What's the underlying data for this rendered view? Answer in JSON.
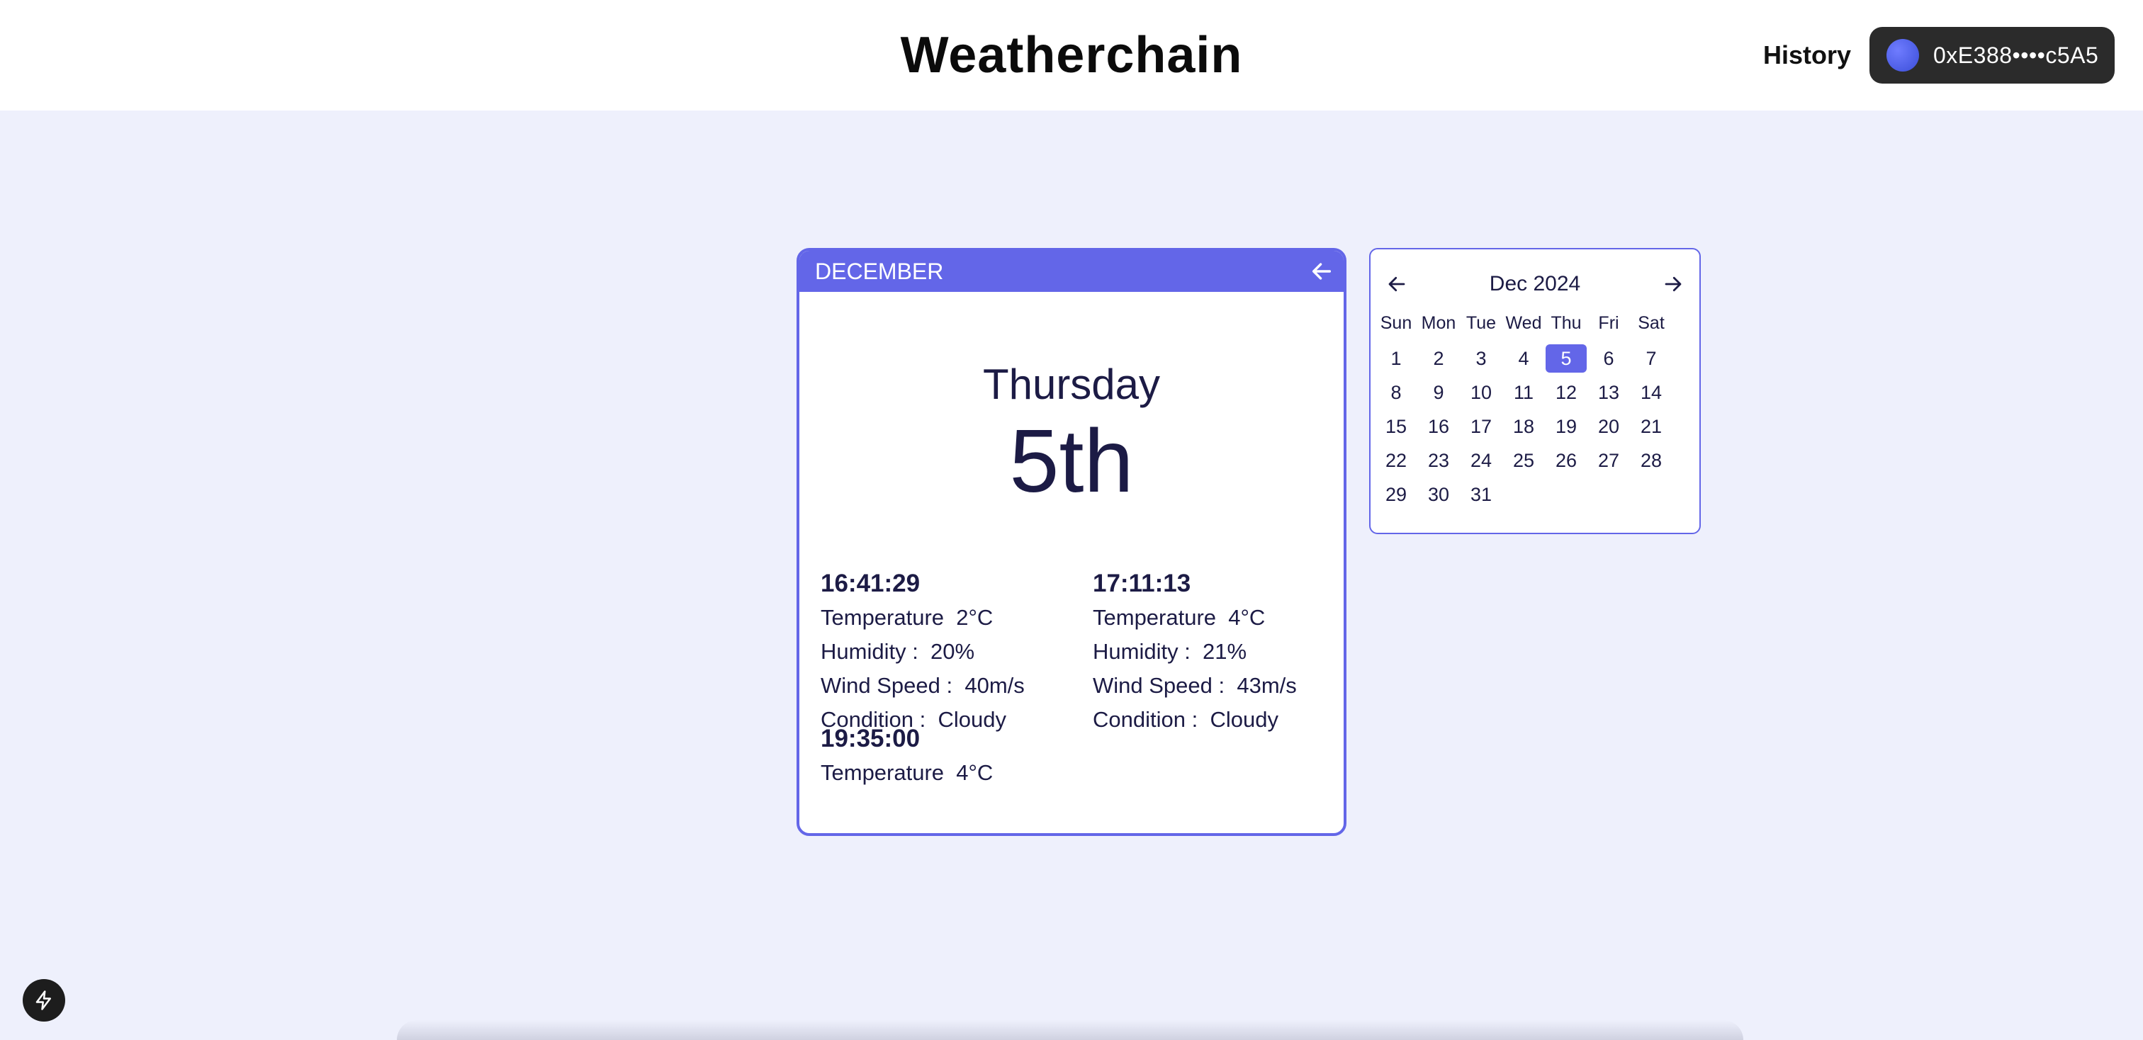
{
  "header": {
    "title": "Weatherchain",
    "history_label": "History",
    "wallet_address": "0xE388••••c5A5"
  },
  "day_card": {
    "month": "DECEMBER",
    "weekday": "Thursday",
    "date": "5th",
    "readings": [
      {
        "time": "16:41:29",
        "temperature_label": "Temperature",
        "temperature": "2°C",
        "humidity_label": "Humidity :",
        "humidity": "20%",
        "wind_label": "Wind Speed :",
        "wind": "40m/s",
        "condition_label": "Condition :",
        "condition": "Cloudy"
      },
      {
        "time": "17:11:13",
        "temperature_label": "Temperature",
        "temperature": "4°C",
        "humidity_label": "Humidity :",
        "humidity": "21%",
        "wind_label": "Wind Speed :",
        "wind": "43m/s",
        "condition_label": "Condition :",
        "condition": "Cloudy"
      },
      {
        "time": "19:35:00",
        "temperature_label": "Temperature",
        "temperature": "4°C"
      }
    ]
  },
  "calendar": {
    "title": "Dec 2024",
    "weekdays": [
      "Sun",
      "Mon",
      "Tue",
      "Wed",
      "Thu",
      "Fri",
      "Sat"
    ],
    "selected_day": 5,
    "days": [
      "1",
      "2",
      "3",
      "4",
      "5",
      "6",
      "7",
      "8",
      "9",
      "10",
      "11",
      "12",
      "13",
      "14",
      "15",
      "16",
      "17",
      "18",
      "19",
      "20",
      "21",
      "22",
      "23",
      "24",
      "25",
      "26",
      "27",
      "28",
      "29",
      "30",
      "31"
    ]
  },
  "colors": {
    "accent": "#6366e8",
    "background": "#eef0fc",
    "text": "#1c1b45"
  }
}
